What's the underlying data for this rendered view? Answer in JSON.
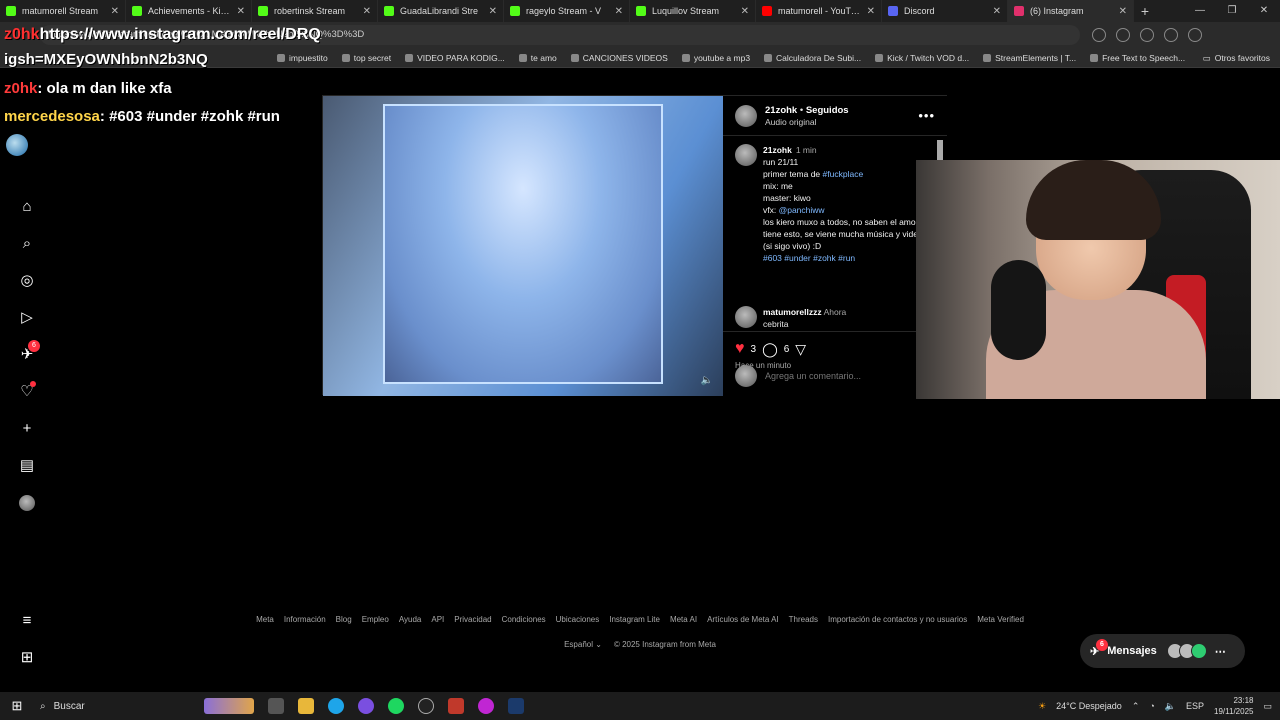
{
  "browser": {
    "tabs": [
      {
        "title": "matumorell Stream",
        "color": "#53fc18"
      },
      {
        "title": "Achievements - Kick Da",
        "color": "#53fc18"
      },
      {
        "title": "robertinsk Stream",
        "color": "#53fc18"
      },
      {
        "title": "GuadaLibrandi Stre",
        "color": "#53fc18"
      },
      {
        "title": "rageylo Stream - V",
        "color": "#53fc18"
      },
      {
        "title": "Luquillov Stream",
        "color": "#53fc18"
      },
      {
        "title": "matumorell - YouTube",
        "color": "#ff0000"
      },
      {
        "title": "Discord",
        "color": "#5865f2"
      },
      {
        "title": "(6) Instagram",
        "color": "#e1306c"
      }
    ],
    "url": "https://www.instagram.com/reel/DRQ...MXEyOWNhbnN2b2x3NQ%3D%3D",
    "bookmarks": [
      "impuestito",
      "top secret",
      "VIDEO PARA KODIG...",
      "te amo",
      "CANCIONES VIDEOS",
      "youtube a mp3",
      "Calculadora De Subi...",
      "Kick / Twitch VOD d...",
      "StreamElements | T...",
      "Free Text to Speech..."
    ],
    "other_bookmarks": "Otros favoritos"
  },
  "overlay": {
    "line1": "https://www.instagram.com/reel/DRQ",
    "line1_user": "z0hk",
    "line2": "igsh=MXEyOWNhbnN2b3NQ",
    "chat1_user": "z0hk",
    "chat1_text": ": ola m dan like xfa",
    "chat2_user": "mercedesosa",
    "chat2_text": ": #603 #under #zohk #run"
  },
  "reel": {
    "username": "21zohk",
    "following": "Seguidos",
    "audio": "Audio original",
    "caption_user": "21zohk",
    "caption_time": "1 min",
    "caption_lines": [
      "run 21/11",
      "primer tema de ",
      "mix: me",
      "master: kiwo",
      "vfx: ",
      "los kiero muxo a todos, no saben el amor que tiene esto, se viene mucha música y videos (si sigo vivo) :D"
    ],
    "caption_tag1": "#fuckplace",
    "caption_mention": "@panchiww",
    "caption_tags": "#603 #under #zohk #run",
    "comment_user": "matumorellzzz",
    "comment_time": "Ahora",
    "comment_text": "cebrita",
    "likes": "3",
    "comments": "6",
    "posted": "Hace un minuto",
    "comment_placeholder": "Agrega un comentario..."
  },
  "sidebar": {
    "notifications_badge": "6"
  },
  "footer": {
    "links": [
      "Meta",
      "Información",
      "Blog",
      "Empleo",
      "Ayuda",
      "API",
      "Privacidad",
      "Condiciones",
      "Ubicaciones",
      "Instagram Lite",
      "Meta AI",
      "Artículos de Meta AI",
      "Threads",
      "Importación de contactos y no usuarios",
      "Meta Verified"
    ],
    "language": "Español",
    "copyright": "© 2025 Instagram from Meta"
  },
  "messages": {
    "label": "Mensajes",
    "badge": "6"
  },
  "taskbar": {
    "search": "Buscar",
    "weather": "24°C  Despejado",
    "weather_badge": "2",
    "lang": "ESP",
    "time": "23:18",
    "date": "19/11/2025"
  }
}
